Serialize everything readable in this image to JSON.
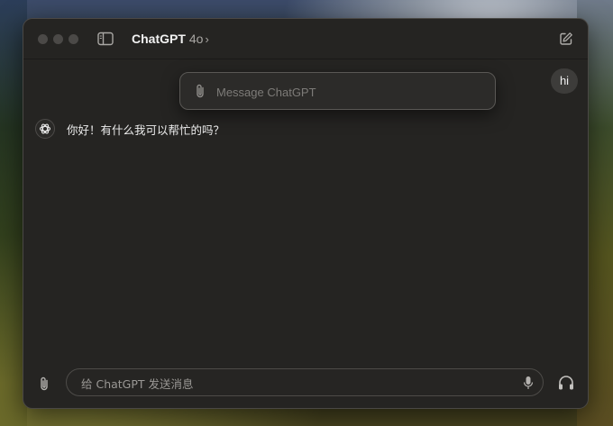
{
  "titlebar": {
    "app_name": "ChatGPT",
    "model": "4o",
    "chevron": "›",
    "icons": [
      "sidebar-toggle-icon",
      "new-chat-icon"
    ]
  },
  "floating_input": {
    "placeholder": "Message ChatGPT",
    "icon": "paperclip-icon"
  },
  "messages": [
    {
      "role": "user",
      "text": "hi"
    },
    {
      "role": "assistant",
      "text": "你好！有什么我可以帮忙的吗？"
    }
  ],
  "composer": {
    "placeholder": "给 ChatGPT 发送消息",
    "icons": [
      "paperclip-icon",
      "microphone-icon",
      "headphones-icon"
    ]
  }
}
